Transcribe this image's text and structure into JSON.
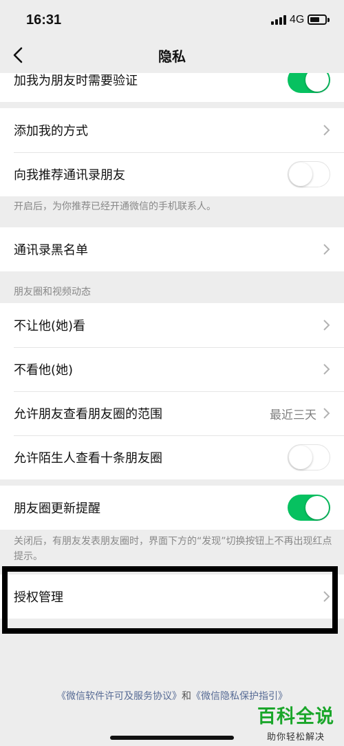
{
  "status_bar": {
    "time": "16:31",
    "network": "4G"
  },
  "nav": {
    "title": "隐私"
  },
  "rows": {
    "verify_friend": {
      "label": "加我为朋友时需要验证",
      "toggle": "on"
    },
    "add_methods": {
      "label": "添加我的方式"
    },
    "recommend_contacts": {
      "label": "向我推荐通讯录朋友",
      "toggle": "off"
    },
    "blacklist": {
      "label": "通讯录黑名单"
    },
    "hide_my_posts": {
      "label": "不让他(她)看"
    },
    "hide_their_posts": {
      "label": "不看他(她)"
    },
    "moments_range": {
      "label": "允许朋友查看朋友圈的范围",
      "value": "最近三天"
    },
    "strangers_view": {
      "label": "允许陌生人查看十条朋友圈",
      "toggle": "off"
    },
    "moments_reminder": {
      "label": "朋友圈更新提醒",
      "toggle": "on"
    },
    "authorization": {
      "label": "授权管理"
    }
  },
  "notes": {
    "recommend_note": "开启后，为你推荐已经开通微信的手机联系人。",
    "moments_section": "朋友圈和视频动态",
    "reminder_note": "关闭后，有朋友发表朋友圈时，界面下方的“发现”切换按钮上不再出现红点提示。"
  },
  "footer": {
    "license_link": "《微信软件许可及服务协议》",
    "joiner": "和",
    "privacy_link": "《微信隐私保护指引》"
  },
  "watermark": {
    "main": "百科全说",
    "sub": "助你轻松解决"
  },
  "colors": {
    "toggle_on": "#07c160",
    "link": "#576b95",
    "background": "#ededed"
  }
}
